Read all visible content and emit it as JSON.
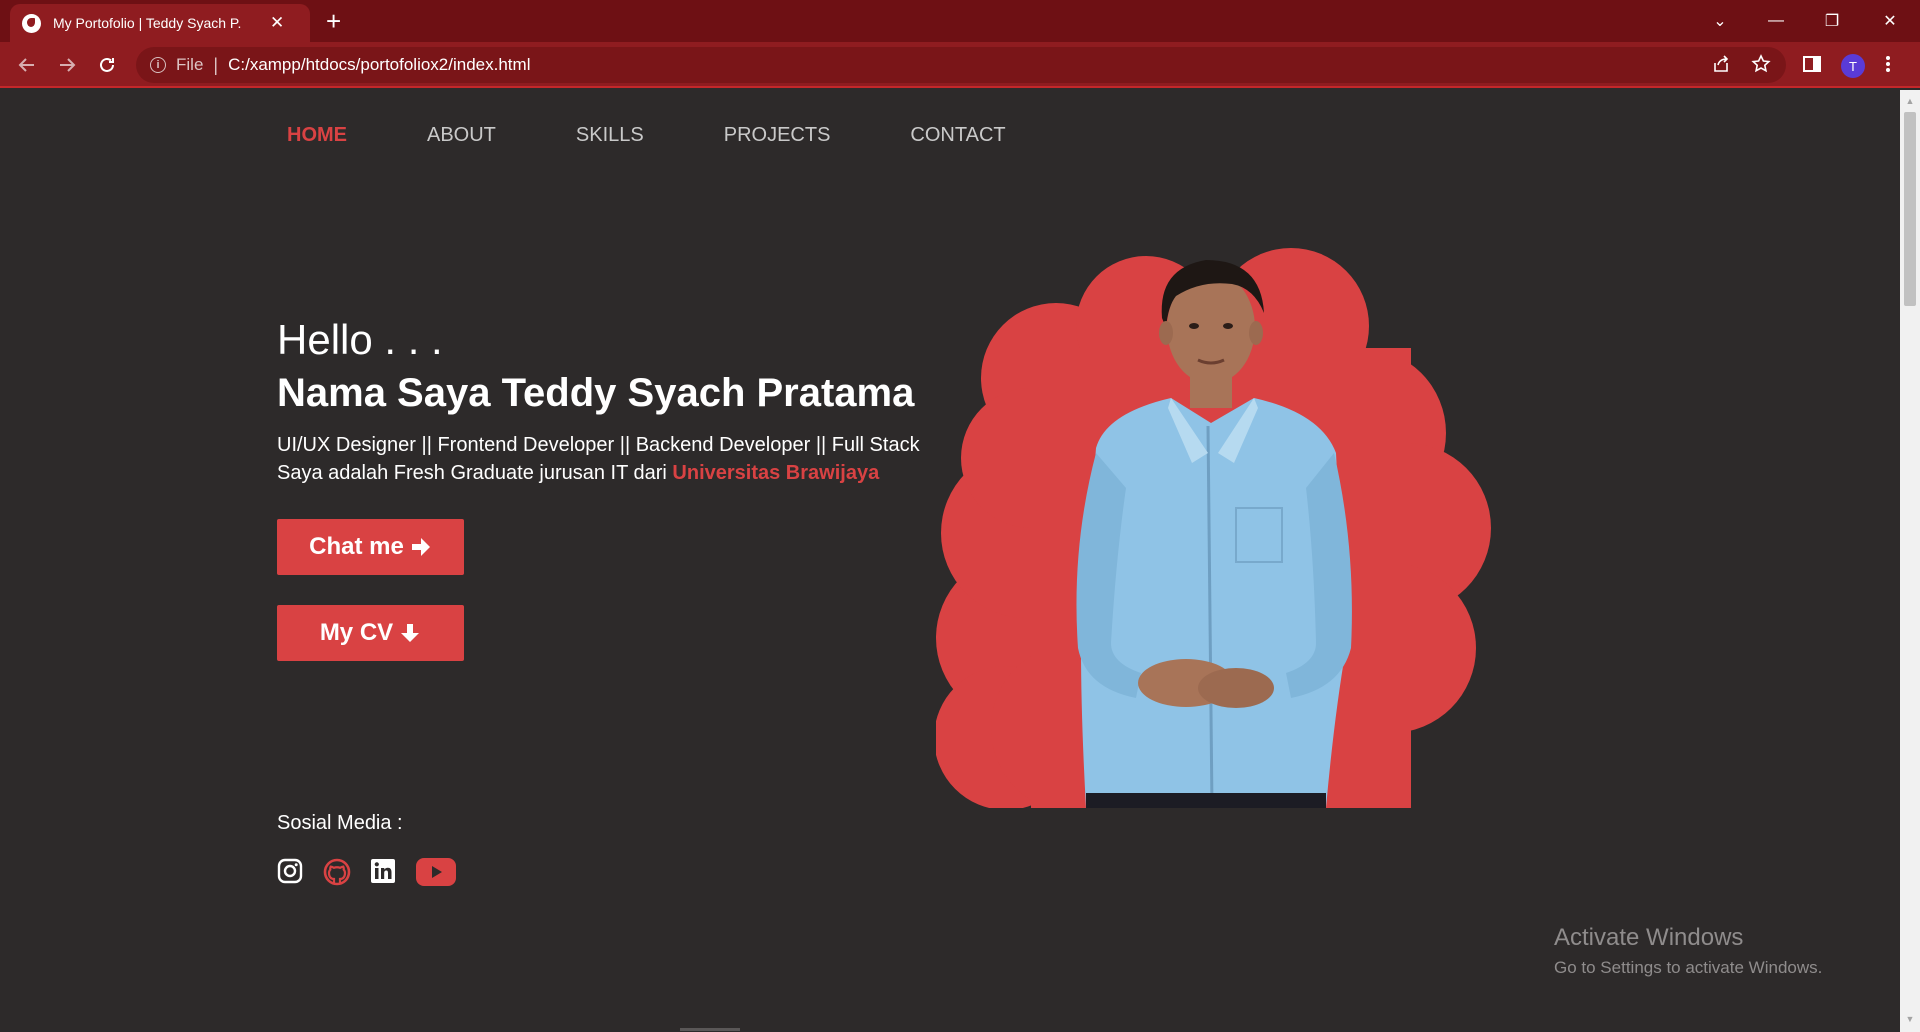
{
  "browser": {
    "tab_title": "My Portofolio | Teddy Syach P.",
    "tab_close": "✕",
    "new_tab": "+",
    "address_scheme_label": "File",
    "address_separator": "|",
    "url": "C:/xampp/htdocs/portofoliox2/index.html",
    "profile_initial": "T",
    "window_controls": {
      "tab_search": "⌄",
      "minimize": "—",
      "restore": "❐",
      "close": "✕"
    }
  },
  "nav": {
    "items": [
      {
        "label": "HOME",
        "active": true
      },
      {
        "label": "ABOUT",
        "active": false
      },
      {
        "label": "SKILLS",
        "active": false
      },
      {
        "label": "PROJECTS",
        "active": false
      },
      {
        "label": "CONTACT",
        "active": false
      }
    ]
  },
  "hero": {
    "greeting": "Hello . . .",
    "name": "Nama Saya Teddy Syach Pratama",
    "roles": "UI/UX Designer || Frontend Developer || Backend Developer || Full Stack",
    "description_prefix": "Saya adalah Fresh Graduate jurusan IT dari ",
    "university": "Universitas Brawijaya",
    "chat_button": "Chat me",
    "cv_button": "My CV"
  },
  "social": {
    "label": "Sosial Media :",
    "icons": [
      "instagram-icon",
      "github-icon",
      "linkedin-icon",
      "youtube-icon"
    ]
  },
  "watermark": {
    "title": "Activate Windows",
    "subtitle": "Go to Settings to activate Windows."
  },
  "colors": {
    "accent": "#d94243",
    "page_background": "#2d2a2a",
    "titlebar": "#6e1014",
    "toolbar": "#8f1c20",
    "shirt": "#8fc3e6"
  }
}
